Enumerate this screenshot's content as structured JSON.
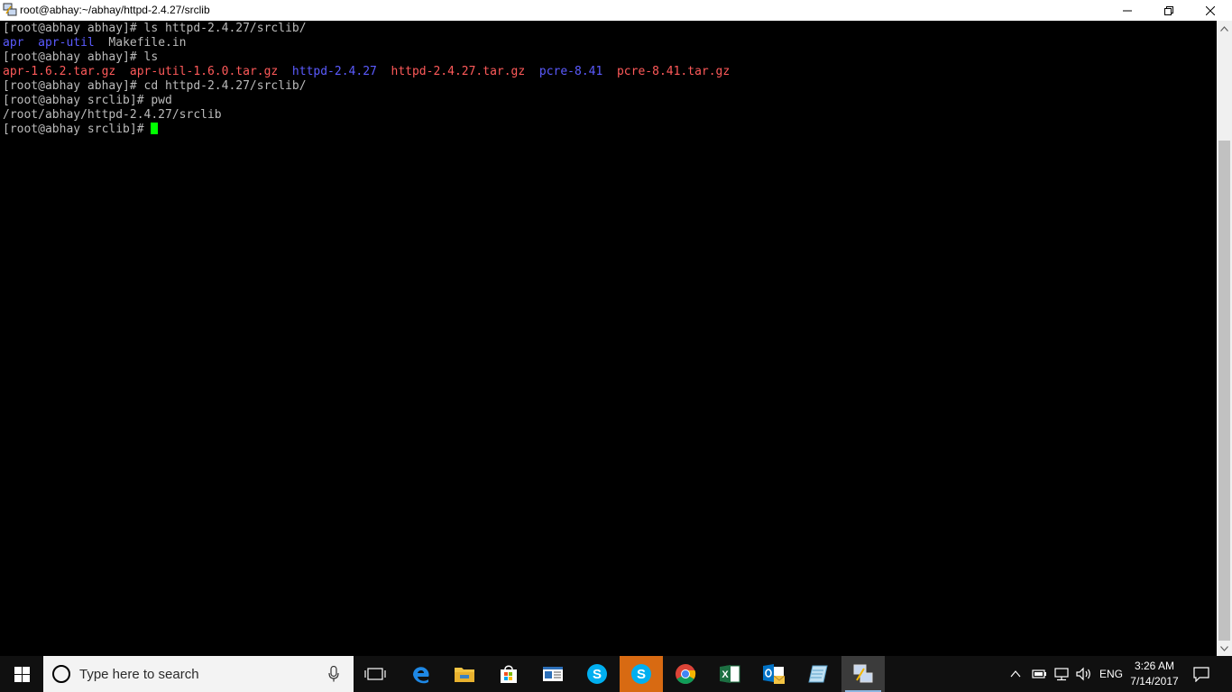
{
  "window": {
    "title": "root@abhay:~/abhay/httpd-2.4.27/srclib",
    "app_icon": "putty-icon",
    "controls": [
      "minimize-icon",
      "restore-icon",
      "close-icon"
    ]
  },
  "terminal": {
    "colors": {
      "text": "#bbbbbb",
      "directory": "#5b5bff",
      "archive": "#ff5a5a",
      "cursor": "#00ff00"
    },
    "lines": [
      {
        "segments": [
          {
            "text": "[root@abhay abhay]# ls httpd-2.4.27/srclib/",
            "style": "plain"
          }
        ]
      },
      {
        "segments": [
          {
            "text": "apr",
            "style": "blue"
          },
          {
            "text": "  ",
            "style": "plain"
          },
          {
            "text": "apr-util",
            "style": "blue"
          },
          {
            "text": "  Makefile.in",
            "style": "plain"
          }
        ]
      },
      {
        "segments": [
          {
            "text": "[root@abhay abhay]# ls",
            "style": "plain"
          }
        ]
      },
      {
        "segments": [
          {
            "text": "apr-1.6.2.tar.gz",
            "style": "red"
          },
          {
            "text": "  ",
            "style": "plain"
          },
          {
            "text": "apr-util-1.6.0.tar.gz",
            "style": "red"
          },
          {
            "text": "  ",
            "style": "plain"
          },
          {
            "text": "httpd-2.4.27",
            "style": "blue"
          },
          {
            "text": "  ",
            "style": "plain"
          },
          {
            "text": "httpd-2.4.27.tar.gz",
            "style": "red"
          },
          {
            "text": "  ",
            "style": "plain"
          },
          {
            "text": "pcre-8.41",
            "style": "blue"
          },
          {
            "text": "  ",
            "style": "plain"
          },
          {
            "text": "pcre-8.41.tar.gz",
            "style": "red"
          }
        ]
      },
      {
        "segments": [
          {
            "text": "[root@abhay abhay]# cd httpd-2.4.27/srclib/",
            "style": "plain"
          }
        ]
      },
      {
        "segments": [
          {
            "text": "[root@abhay srclib]# pwd",
            "style": "plain"
          }
        ]
      },
      {
        "segments": [
          {
            "text": "/root/abhay/httpd-2.4.27/srclib",
            "style": "plain"
          }
        ]
      },
      {
        "segments": [
          {
            "text": "[root@abhay srclib]# ",
            "style": "plain"
          }
        ],
        "cursor": true
      }
    ]
  },
  "taskbar": {
    "search_placeholder": "Type here to search",
    "apps": [
      {
        "name": "task-view-icon",
        "state": "normal"
      },
      {
        "name": "edge-icon",
        "state": "normal"
      },
      {
        "name": "file-explorer-icon",
        "state": "normal"
      },
      {
        "name": "store-icon",
        "state": "normal"
      },
      {
        "name": "news-icon",
        "state": "normal"
      },
      {
        "name": "skype-icon",
        "state": "normal"
      },
      {
        "name": "skype-business-icon",
        "state": "active"
      },
      {
        "name": "chrome-icon",
        "state": "normal"
      },
      {
        "name": "excel-icon",
        "state": "normal"
      },
      {
        "name": "outlook-icon",
        "state": "normal"
      },
      {
        "name": "notepad-icon",
        "state": "normal"
      },
      {
        "name": "putty-icon",
        "state": "focused"
      }
    ],
    "tray": {
      "icons": [
        "show-hidden-icons-chevron",
        "battery-icon",
        "network-icon",
        "volume-icon"
      ],
      "language": "ENG",
      "time": "3:26 AM",
      "date": "7/14/2017"
    }
  }
}
